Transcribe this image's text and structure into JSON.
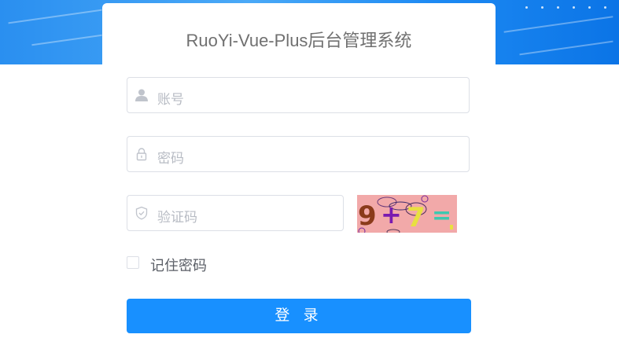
{
  "login": {
    "title": "RuoYi-Vue-Plus后台管理系统",
    "username": {
      "placeholder": "账号",
      "value": ""
    },
    "password": {
      "placeholder": "密码",
      "value": ""
    },
    "captcha": {
      "placeholder": "验证码",
      "value": "",
      "image_text": [
        "9",
        "+",
        "7",
        "="
      ],
      "image_bg": "#f2a9a9"
    },
    "remember_label": "记住密码",
    "remember_checked": false,
    "login_button_label": "登 录"
  },
  "colors": {
    "primary": "#1890ff",
    "header_bg": "#2a8ff0"
  }
}
